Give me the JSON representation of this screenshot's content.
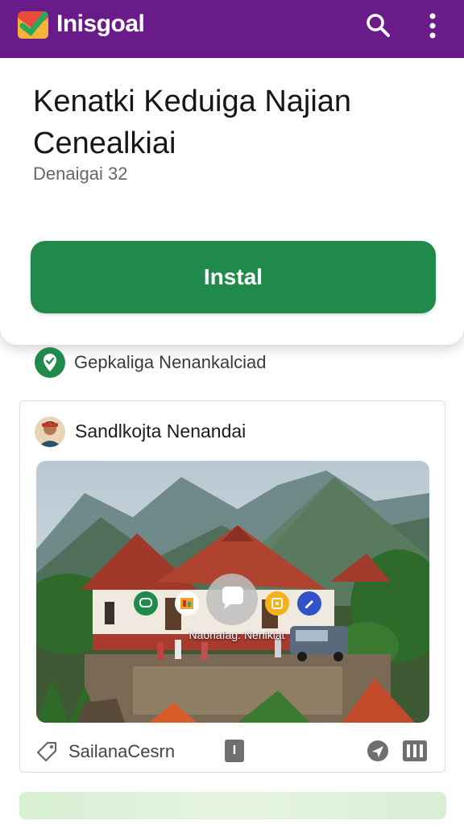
{
  "header": {
    "app_title": "Inisgoal",
    "brand_color": "#6a1b8a",
    "icons": [
      "logo-icon",
      "search-icon",
      "more-vert-icon"
    ]
  },
  "hero": {
    "title_line1": "Kenatki Keduiga Najian",
    "title_line2": "Cenealkiai",
    "subtitle": "Denaigai 32",
    "install_label": "Instal",
    "install_color": "#1f8a4c"
  },
  "verified": {
    "label": "Gepkaliga Nenankalciad",
    "icon": "verified-shield-icon"
  },
  "post": {
    "author": "Sandlkojta Nenandai",
    "media": {
      "caption": "Naonafag: Nenikiat",
      "icons": [
        "chat-bubble-icon",
        "photo-icon",
        "play-comment-icon",
        "image-badge-icon",
        "edit-icon"
      ]
    },
    "footer": {
      "location": "SailanaCesrn",
      "info_badge": "I",
      "icons": [
        "tag-icon",
        "share-icon",
        "film-icon"
      ]
    }
  }
}
